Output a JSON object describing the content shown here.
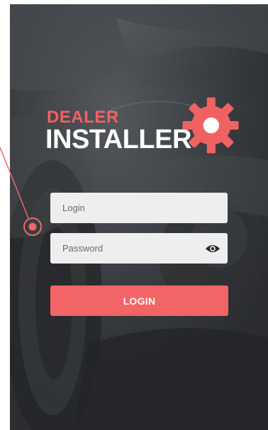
{
  "brand": {
    "line1": "DEALER",
    "line2": "INSTALLER"
  },
  "form": {
    "login_placeholder": "Login",
    "password_placeholder": "Password",
    "submit_label": "LOGIN"
  },
  "icons": {
    "gear": "gear-icon",
    "eye": "eye-icon",
    "callout": "callout-marker-icon"
  },
  "colors": {
    "accent": "#f26466",
    "brand_accent": "#f06262",
    "field_bg": "#eeeeee",
    "background": "#3a3c3e"
  }
}
